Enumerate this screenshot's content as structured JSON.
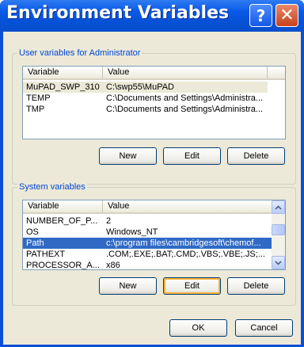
{
  "window": {
    "title": "Environment Variables",
    "help_glyph": "?",
    "close_glyph": "✕"
  },
  "user_vars": {
    "group_label": "User variables for Administrator",
    "columns": {
      "variable": "Variable",
      "value": "Value"
    },
    "rows": [
      {
        "variable": "MuPAD_SWP_310",
        "value": "C:\\swp55\\MuPAD",
        "selected": true
      },
      {
        "variable": "TEMP",
        "value": "C:\\Documents and Settings\\Administra..."
      },
      {
        "variable": "TMP",
        "value": "C:\\Documents and Settings\\Administra..."
      }
    ],
    "buttons": {
      "new": "New",
      "edit": "Edit",
      "delete": "Delete"
    }
  },
  "system_vars": {
    "group_label": "System variables",
    "columns": {
      "variable": "Variable",
      "value": "Value"
    },
    "rows": [
      {
        "variable": "NUMBER_OF_P...",
        "value": "2"
      },
      {
        "variable": "OS",
        "value": "Windows_NT"
      },
      {
        "variable": "Path",
        "value": "c:\\program files\\cambridgesoft\\chemof...",
        "selected": true
      },
      {
        "variable": "PATHEXT",
        "value": ".COM;.EXE;.BAT;.CMD;.VBS;.VBE;.JS;..."
      },
      {
        "variable": "PROCESSOR_A...",
        "value": "x86"
      }
    ],
    "buttons": {
      "new": "New",
      "edit": "Edit",
      "delete": "Delete"
    }
  },
  "footer": {
    "ok": "OK",
    "cancel": "Cancel"
  },
  "icons": {
    "scroll_up": "chevron-up-icon",
    "scroll_down": "chevron-down-icon"
  },
  "colors": {
    "title_bar": "#0a5ae8",
    "selection": "#316ac5",
    "group_label": "#0046d5",
    "dialog_bg": "#ece9d8"
  }
}
